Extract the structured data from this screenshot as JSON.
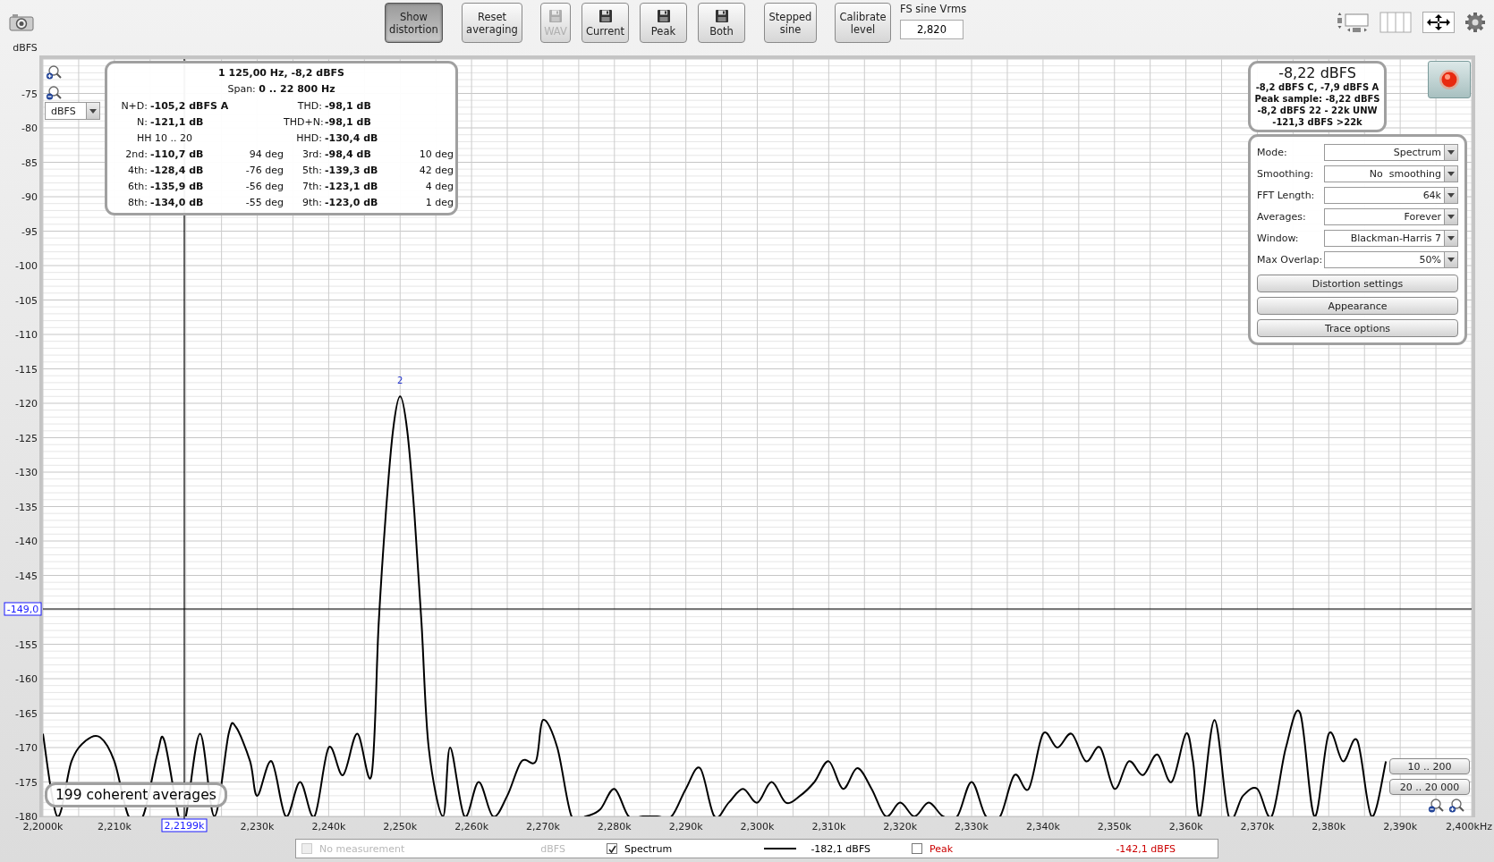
{
  "toolbar": {
    "buttons": [
      {
        "label": "Show distortion",
        "kind": "text",
        "selected": true,
        "disabled": false
      },
      {
        "label": "Reset averaging",
        "kind": "text",
        "selected": false,
        "disabled": false
      },
      {
        "label": "WAV",
        "kind": "save",
        "selected": false,
        "disabled": true
      },
      {
        "label": "Current",
        "kind": "save",
        "selected": false,
        "disabled": false
      },
      {
        "label": "Peak",
        "kind": "save",
        "selected": false,
        "disabled": false
      },
      {
        "label": "Both",
        "kind": "save",
        "selected": false,
        "disabled": false
      },
      {
        "label": "Stepped sine",
        "kind": "text",
        "selected": false,
        "disabled": false
      },
      {
        "label": "Calibrate level",
        "kind": "text",
        "selected": false,
        "disabled": false
      }
    ],
    "fs_sine": {
      "label": "FS sine Vrms",
      "value": "2,820"
    }
  },
  "chart": {
    "unit_selector": "dBFS",
    "cursor": {
      "x_readout": "2,2199k",
      "y_readout": "-149,0"
    },
    "averages": "199 coherent averages",
    "range_buttons": [
      "10 .. 200",
      "20 .. 20 000"
    ],
    "chart_data": {
      "type": "line",
      "grid": true,
      "ylabel": "dBFS",
      "xlim": [
        2200,
        2400
      ],
      "ylim": [
        -180,
        -70
      ],
      "x": [
        2200,
        2202,
        2204,
        2206,
        2208,
        2210,
        2212,
        2214,
        2216,
        2217,
        2219,
        2220,
        2222,
        2224,
        2226,
        2227,
        2229,
        2230,
        2232,
        2234,
        2236,
        2238,
        2240,
        2242,
        2244,
        2246,
        2247,
        2248,
        2249,
        2250,
        2251,
        2252,
        2253,
        2254,
        2256,
        2257,
        2259,
        2261,
        2263,
        2265,
        2267,
        2269,
        2270,
        2272,
        2274,
        2276,
        2278,
        2280,
        2282,
        2284,
        2286,
        2288,
        2290,
        2292,
        2294,
        2296,
        2298,
        2300,
        2302,
        2304,
        2306,
        2308,
        2310,
        2312,
        2314,
        2316,
        2318,
        2320,
        2322,
        2324,
        2326,
        2328,
        2330,
        2332,
        2334,
        2336,
        2338,
        2340,
        2342,
        2344,
        2346,
        2348,
        2350,
        2352,
        2354,
        2356,
        2358,
        2360,
        2361,
        2362,
        2364,
        2366,
        2368,
        2370,
        2372,
        2374,
        2376,
        2378,
        2380,
        2382,
        2384,
        2386,
        2388
      ],
      "series": [
        {
          "color": "#000000",
          "values": [
            -168,
            -180,
            -172,
            -169,
            -168.5,
            -172,
            -180,
            -180,
            -171,
            -169,
            -180,
            -180,
            -168,
            -180,
            -168,
            -167,
            -172,
            -177,
            -172,
            -180,
            -175,
            -180,
            -170,
            -174,
            -168,
            -174,
            -152,
            -136,
            -124,
            -119,
            -124,
            -136,
            -152,
            -170,
            -180,
            -170,
            -180,
            -175,
            -180,
            -177,
            -172,
            -172,
            -166,
            -170,
            -180,
            -180,
            -179,
            -176,
            -180,
            -180,
            -180,
            -180,
            -176,
            -173,
            -180,
            -178,
            -176,
            -178,
            -175,
            -178,
            -177,
            -175,
            -172,
            -176,
            -173,
            -176,
            -180,
            -178,
            -180,
            -178,
            -180,
            -180,
            -175,
            -180,
            -180,
            -174,
            -176,
            -168,
            -170,
            -168,
            -172,
            -170,
            -176,
            -172,
            -174,
            -171,
            -175,
            -168,
            -172,
            -180,
            -166,
            -180,
            -177,
            -176,
            -180,
            -170,
            -165,
            -180,
            -168,
            -172,
            -169,
            -180,
            -172
          ]
        }
      ],
      "xticks": [
        {
          "value": 2200,
          "label": "2,2000k"
        },
        {
          "value": 2210,
          "label": "2,210k"
        },
        {
          "value": 2230,
          "label": "2,230k"
        },
        {
          "value": 2240,
          "label": "2,240k"
        },
        {
          "value": 2250,
          "label": "2,250k"
        },
        {
          "value": 2260,
          "label": "2,260k"
        },
        {
          "value": 2270,
          "label": "2,270k"
        },
        {
          "value": 2280,
          "label": "2,280k"
        },
        {
          "value": 2290,
          "label": "2,290k"
        },
        {
          "value": 2300,
          "label": "2,300k"
        },
        {
          "value": 2310,
          "label": "2,310k"
        },
        {
          "value": 2320,
          "label": "2,320k"
        },
        {
          "value": 2330,
          "label": "2,330k"
        },
        {
          "value": 2340,
          "label": "2,340k"
        },
        {
          "value": 2350,
          "label": "2,350k"
        },
        {
          "value": 2360,
          "label": "2,360k"
        },
        {
          "value": 2370,
          "label": "2,370k"
        },
        {
          "value": 2380,
          "label": "2,380k"
        },
        {
          "value": 2390,
          "label": "2,390k"
        },
        {
          "value": 2400,
          "label": "2,400kHz"
        }
      ],
      "yticks": [
        {
          "value": -75,
          "label": "-75"
        },
        {
          "value": -80,
          "label": "-80"
        },
        {
          "value": -85,
          "label": "-85"
        },
        {
          "value": -90,
          "label": "-90"
        },
        {
          "value": -95,
          "label": "-95"
        },
        {
          "value": -100,
          "label": "-100"
        },
        {
          "value": -105,
          "label": "-105"
        },
        {
          "value": -110,
          "label": "-110"
        },
        {
          "value": -115,
          "label": "-115"
        },
        {
          "value": -120,
          "label": "-120"
        },
        {
          "value": -125,
          "label": "-125"
        },
        {
          "value": -130,
          "label": "-130"
        },
        {
          "value": -135,
          "label": "-135"
        },
        {
          "value": -140,
          "label": "-140"
        },
        {
          "value": -145,
          "label": "-145"
        },
        {
          "value": -155,
          "label": "-155"
        },
        {
          "value": -160,
          "label": "-160"
        },
        {
          "value": -165,
          "label": "-165"
        },
        {
          "value": -170,
          "label": "-170"
        },
        {
          "value": -175,
          "label": "-175"
        },
        {
          "value": -180,
          "label": "-180"
        }
      ],
      "annotations": [
        {
          "text": "2",
          "x": 2250,
          "y": -119
        }
      ]
    }
  },
  "distortion": {
    "title": "1 125,00 Hz, -8,2 dBFS",
    "span": "Span: **0 .. 22 800 Hz**",
    "rows": [
      {
        "cells": [
          {
            "kind": "reading",
            "label": "N+D:",
            "value": "-105,2 dBFS A"
          },
          {
            "kind": "reading",
            "label": "THD:",
            "value": "-98,1 dB"
          }
        ]
      },
      {
        "cells": [
          {
            "kind": "reading",
            "label": "N:",
            "value": "-121,1 dB"
          },
          {
            "kind": "reading",
            "label": "THD+N:",
            "value": "-98,1 dB"
          }
        ]
      },
      {
        "cells": [
          {
            "kind": "note",
            "label": "HH 10 .. 20"
          },
          {
            "kind": "reading",
            "label": "HHD:",
            "value": "-130,4 dB"
          }
        ]
      },
      {
        "cells": [
          {
            "kind": "reading",
            "label": "2nd:",
            "value": "-110,7 dB",
            "phase": "94 deg"
          },
          {
            "kind": "reading",
            "label": "3rd:",
            "value": "-98,4 dB",
            "phase": "10 deg"
          }
        ]
      },
      {
        "cells": [
          {
            "kind": "reading",
            "label": "4th:",
            "value": "-128,4 dB",
            "phase": "-76 deg"
          },
          {
            "kind": "reading",
            "label": "5th:",
            "value": "-139,3 dB",
            "phase": "42 deg"
          }
        ]
      },
      {
        "cells": [
          {
            "kind": "reading",
            "label": "6th:",
            "value": "-135,9 dB",
            "phase": "-56 deg"
          },
          {
            "kind": "reading",
            "label": "7th:",
            "value": "-123,1 dB",
            "phase": "4 deg"
          }
        ]
      },
      {
        "cells": [
          {
            "kind": "reading",
            "label": "8th:",
            "value": "-134,0 dB",
            "phase": "-55 deg"
          },
          {
            "kind": "reading",
            "label": "9th:",
            "value": "-123,0 dB",
            "phase": "1 deg"
          }
        ]
      }
    ]
  },
  "level": {
    "reading": "-8,22 dBFS",
    "lines": [
      "-8,2 dBFS C, -7,9 dBFS A",
      "Peak sample: -8,22 dBFS",
      "-8,2 dBFS 22 - 22k UNW",
      "-121,3 dBFS >22k"
    ]
  },
  "settings": {
    "fields": [
      {
        "label": "Mode:",
        "value": "Spectrum"
      },
      {
        "label": "Smoothing:",
        "value": "No  smoothing"
      },
      {
        "label": "FFT Length:",
        "value": "64k"
      },
      {
        "label": "Averages:",
        "value": "Forever"
      },
      {
        "label": "Window:",
        "value": "Blackman-Harris 7"
      },
      {
        "label": "Max Overlap:",
        "value": "50%"
      }
    ],
    "buttons": [
      "Distortion settings",
      "Appearance",
      "Trace options"
    ]
  },
  "legend": {
    "items": [
      {
        "label": "No measurement",
        "reading": "dBFS",
        "checked": false,
        "disabled": true,
        "color": "#b8b8b8"
      },
      {
        "label": "Spectrum",
        "reading": "-182,1 dBFS",
        "checked": true,
        "disabled": false,
        "color": "#000000"
      },
      {
        "label": "Peak",
        "reading": "-142,1 dBFS",
        "checked": false,
        "disabled": false,
        "color": "#cc0000"
      }
    ]
  }
}
